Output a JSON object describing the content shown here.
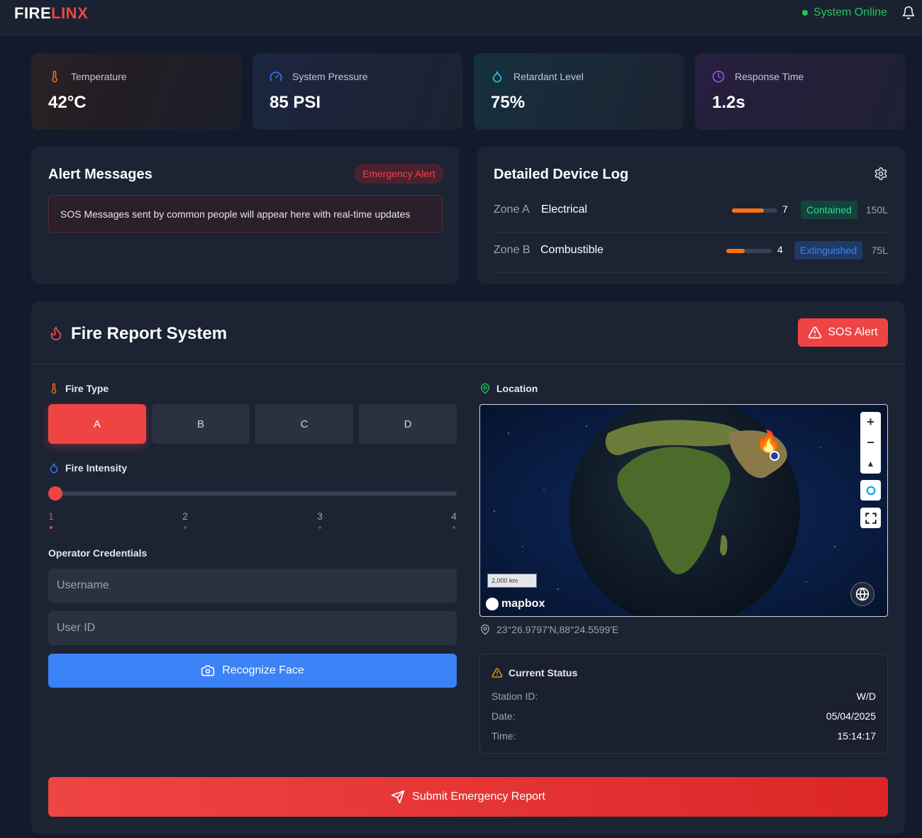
{
  "header": {
    "logo_part1": "FIRE",
    "logo_part2": "LINX",
    "system_status": "System Online",
    "bell_icon": "bell-icon"
  },
  "metrics": [
    {
      "label": "Temperature",
      "value": "42°C",
      "icon": "thermometer-icon",
      "color": "#f97316"
    },
    {
      "label": "System Pressure",
      "value": "85 PSI",
      "icon": "gauge-icon",
      "color": "#3b82f6"
    },
    {
      "label": "Retardant Level",
      "value": "75%",
      "icon": "droplet-icon",
      "color": "#22d3ee"
    },
    {
      "label": "Response Time",
      "value": "1.2s",
      "icon": "clock-icon",
      "color": "#a855f7"
    }
  ],
  "alerts": {
    "title": "Alert Messages",
    "badge": "Emergency Alert",
    "message": "SOS Messages sent by common people will appear here with real-time updates"
  },
  "device_log": {
    "title": "Detailed Device Log",
    "rows": [
      {
        "zone": "Zone A",
        "type": "Electrical",
        "level": 0.7,
        "count": "7",
        "status": "Contained",
        "amount": "150L"
      },
      {
        "zone": "Zone B",
        "type": "Combustible",
        "level": 0.4,
        "count": "4",
        "status": "Extinguished",
        "amount": "75L"
      }
    ]
  },
  "fire_report": {
    "title": "Fire Report System",
    "sos_button": "SOS Alert",
    "fire_type_label": "Fire Type",
    "fire_types": [
      "A",
      "B",
      "C",
      "D"
    ],
    "selected_type": "A",
    "intensity_label": "Fire Intensity",
    "intensity_ticks": [
      "1",
      "2",
      "3",
      "4"
    ],
    "intensity_value": 1,
    "credentials_label": "Operator Credentials",
    "username_placeholder": "Username",
    "userid_placeholder": "User ID",
    "face_button": "Recognize Face",
    "location_label": "Location",
    "map": {
      "scale": "2,000 km",
      "attribution": "mapbox",
      "zoom_in": "+",
      "zoom_out": "−"
    },
    "coordinates": "23°26.9797'N,88°24.5599'E",
    "status": {
      "title": "Current Status",
      "station_label": "Station ID:",
      "station_value": "W/D",
      "date_label": "Date:",
      "date_value": "05/04/2025",
      "time_label": "Time:",
      "time_value": "15:14:17"
    },
    "submit_button": "Submit Emergency Report"
  },
  "colors": {
    "accent_red": "#ef4444",
    "accent_blue": "#3b82f6",
    "online_green": "#22c55e",
    "background": "#121a2b"
  }
}
